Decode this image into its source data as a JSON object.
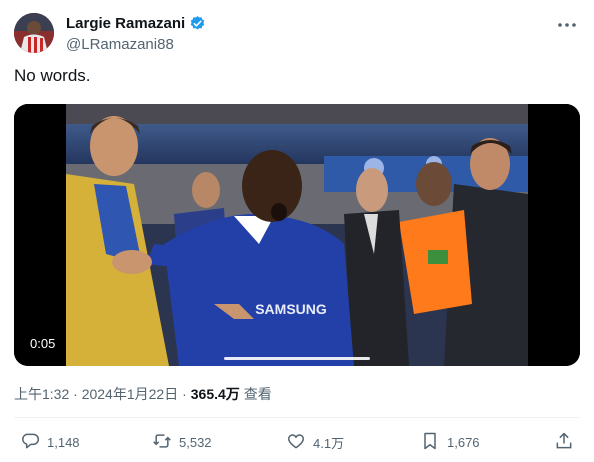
{
  "author": {
    "display_name": "Largie Ramazani",
    "handle": "@LRamazani88",
    "verified": true
  },
  "icons": {
    "verified": "verified-badge-icon",
    "more": "more-options-icon",
    "reply": "reply-icon",
    "retweet": "retweet-icon",
    "like": "like-icon",
    "bookmark": "bookmark-icon",
    "share": "share-icon"
  },
  "tweet": {
    "text": "No words."
  },
  "media": {
    "type": "video",
    "duration": "0:05",
    "jersey_text": "SAMSUNG"
  },
  "meta": {
    "time_date": "上午1:32 · 2024年1月22日 · ",
    "views_count": "365.4万",
    "views_label": "查看"
  },
  "actions": {
    "replies": "1,148",
    "retweets": "5,532",
    "likes": "4.1万",
    "bookmarks": "1,676"
  },
  "colors": {
    "text_primary": "#0f1419",
    "text_secondary": "#536471",
    "verified_blue": "#1d9bf0",
    "divider": "#eff3f4"
  }
}
